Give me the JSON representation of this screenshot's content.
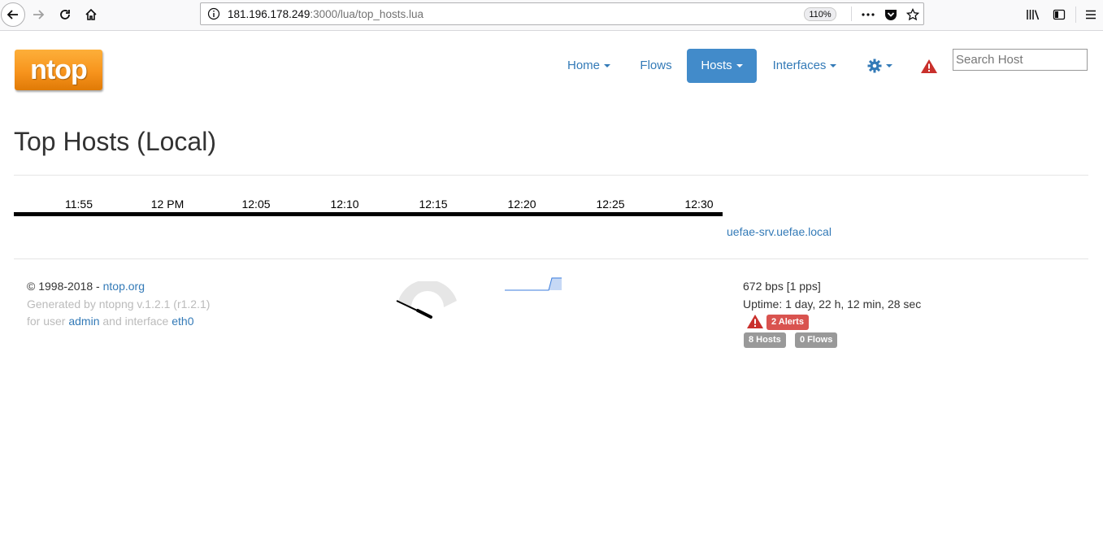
{
  "browser": {
    "url_host": "181.196.178.249",
    "url_rest": ":3000/lua/top_hosts.lua",
    "zoom": "110%",
    "icons": [
      "back-arrow-icon",
      "forward-arrow-icon",
      "reload-icon",
      "home-icon",
      "info-icon",
      "more-icon",
      "pocket-icon",
      "star-icon",
      "library-icon",
      "sidebar-icon",
      "menu-icon"
    ]
  },
  "nav": {
    "logo": "ntop",
    "home": "Home",
    "flows": "Flows",
    "hosts": "Hosts",
    "interfaces": "Interfaces",
    "search_placeholder": "Search Host"
  },
  "page": {
    "title": "Top Hosts (Local)"
  },
  "timeline": {
    "ticks": [
      "11:55",
      "12 PM",
      "12:05",
      "12:10",
      "12:15",
      "12:20",
      "12:25",
      "12:30"
    ],
    "host": "uefae-srv.uefae.local"
  },
  "footer": {
    "copyright": "© 1998-2018 - ",
    "site": "ntop.org",
    "generated": "Generated by ntopng v.1.2.1 (r1.2.1)",
    "for_user": "for user ",
    "user": "admin",
    "and_interface": " and interface ",
    "interface": "eth0",
    "throughput": "672 bps [1 pps]",
    "uptime": "Uptime: 1 day, 22 h, 12 min, 28 sec",
    "alerts_badge": "2 Alerts",
    "hosts_badge": "8 Hosts",
    "flows_badge": "0 Flows"
  },
  "colors": {
    "link": "#337ab7",
    "active_nav": "#428bca",
    "alert_red": "#d9534f",
    "badge_gray": "#999999",
    "logo_orange": "#f7941d"
  }
}
